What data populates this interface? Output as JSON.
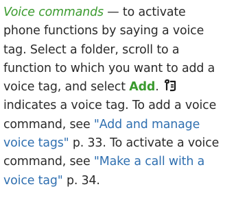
{
  "paragraph": {
    "term": "Voice commands",
    "l1_rest": " — to activate",
    "l2": "phone functions by saying a voice",
    "l3": "tag. Select a folder, scroll to a",
    "l4": "function to which you want to add a",
    "l5_pre": "voice tag, and select ",
    "add_label": "Add",
    "l5_post": ".",
    "voice_tag_icon": "voice-tag-icon",
    "l6": "indicates a voice tag. To add a voice",
    "l7_pre": "command, see ",
    "link1_part1": "\"Add and manage",
    "link1_part2": "voice tags\"",
    "l8_mid": " p. 33. To activate a voice",
    "l9_pre": "command, see ",
    "link2_part1": "\"Make a call with a",
    "link2_part2": "voice tag\"",
    "l10_post": " p. 34."
  },
  "colors": {
    "text": "#2a2a2a",
    "term_green": "#3a9a2e",
    "link_blue": "#2f6fb0"
  }
}
